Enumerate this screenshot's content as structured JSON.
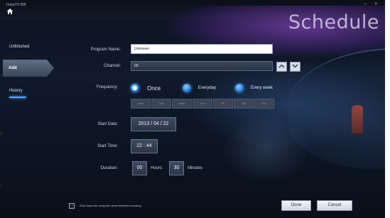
{
  "window": {
    "app_title": "InstaTV Bill",
    "page_title": "Schedule",
    "controls": "– ×"
  },
  "sidebar": {
    "items": [
      {
        "label": "Unfinished"
      },
      {
        "label": "Add"
      },
      {
        "label": "History"
      }
    ]
  },
  "form": {
    "program_name": {
      "label": "Program Name:",
      "value": "Unknown"
    },
    "channel": {
      "label": "Channel:",
      "value": "09"
    },
    "frequency": {
      "label": "Frequency:",
      "options": [
        {
          "label": "Once",
          "checked": true
        },
        {
          "label": "Everyday",
          "checked": false
        },
        {
          "label": "Every week",
          "checked": false
        }
      ],
      "days": [
        "Mon",
        "Tue",
        "Wed",
        "Thu",
        "Fri",
        "Sat",
        "Sun"
      ]
    },
    "start_date": {
      "label": "Start Date:",
      "value": "2013 / 04 / 22"
    },
    "start_time": {
      "label": "Start Time:",
      "value": "22 : 44"
    },
    "duration": {
      "label": "Duration:",
      "hours_value": "00",
      "hours_label": "Hours",
      "minutes_value": "30",
      "minutes_label": "Minutes"
    }
  },
  "footer": {
    "shutdown_label": "Shut down the computer when finished recording",
    "shutdown_checked": false,
    "done_button": "Done",
    "cancel_button": "Cancel"
  },
  "background_glyphs": [
    "3",
    "g"
  ],
  "colors": {
    "accent": "#5aa8ff",
    "banner_glow": "#a854e6",
    "panel_bg": "#0c1220"
  }
}
